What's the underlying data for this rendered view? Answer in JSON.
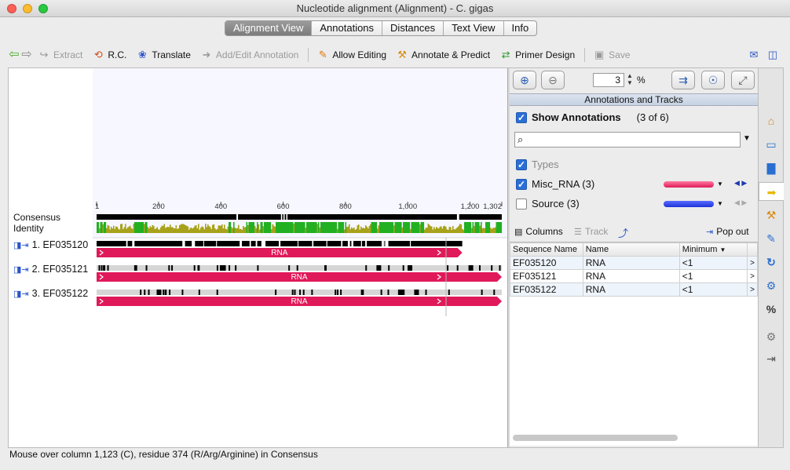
{
  "window": {
    "title": "Nucleotide alignment (Alignment) - C. gigas",
    "lights": [
      "#fc5f57",
      "#fdbc2e",
      "#28c840"
    ]
  },
  "tabs": [
    {
      "label": "Alignment View",
      "active": true
    },
    {
      "label": "Annotations",
      "active": false
    },
    {
      "label": "Distances",
      "active": false
    },
    {
      "label": "Text View",
      "active": false
    },
    {
      "label": "Info",
      "active": false
    }
  ],
  "toolbar": {
    "extract": "Extract",
    "rc": "R.C.",
    "translate": "Translate",
    "add_edit": "Add/Edit Annotation",
    "allow_editing": "Allow Editing",
    "annotate_predict": "Annotate & Predict",
    "primer_design": "Primer Design",
    "save": "Save"
  },
  "ruler": {
    "ticks": [
      "1",
      "200",
      "400",
      "600",
      "800",
      "1,000",
      "1,200",
      "1,302"
    ],
    "length": 1302
  },
  "labels": {
    "consensus": "Consensus",
    "identity": "Identity"
  },
  "sequences": [
    {
      "name": "1. EF035120",
      "annotation": "RNA"
    },
    {
      "name": "2. EF035121",
      "annotation": "RNA"
    },
    {
      "name": "3. EF035122",
      "annotation": "RNA"
    }
  ],
  "colors": {
    "annotation": "#e0195a",
    "identity_high": "#22b022",
    "identity_mid": "#a8a21a",
    "source": "#1c33d8",
    "accent": "#2b6fd6"
  },
  "zoom": {
    "value": "3",
    "unit": "%"
  },
  "panel": {
    "header": "Annotations and Tracks",
    "show_annotations": "Show Annotations",
    "count": "(3 of 6)",
    "search_placeholder": "",
    "types_label": "Types",
    "types": [
      {
        "name": "Misc_RNA (3)",
        "checked": true
      },
      {
        "name": "Source (3)",
        "checked": false
      }
    ],
    "columns": "Columns",
    "track": "Track",
    "pop_out": "Pop out"
  },
  "table": {
    "headers": [
      "Sequence Name",
      "Name",
      "Minimum"
    ],
    "rows": [
      [
        "EF035120",
        "RNA",
        "<1"
      ],
      [
        "EF035121",
        "RNA",
        "<1"
      ],
      [
        "EF035122",
        "RNA",
        "<1"
      ]
    ]
  },
  "status": "Mouse over column 1,123 (C), residue 374 (R/Arg/Arginine) in Consensus"
}
